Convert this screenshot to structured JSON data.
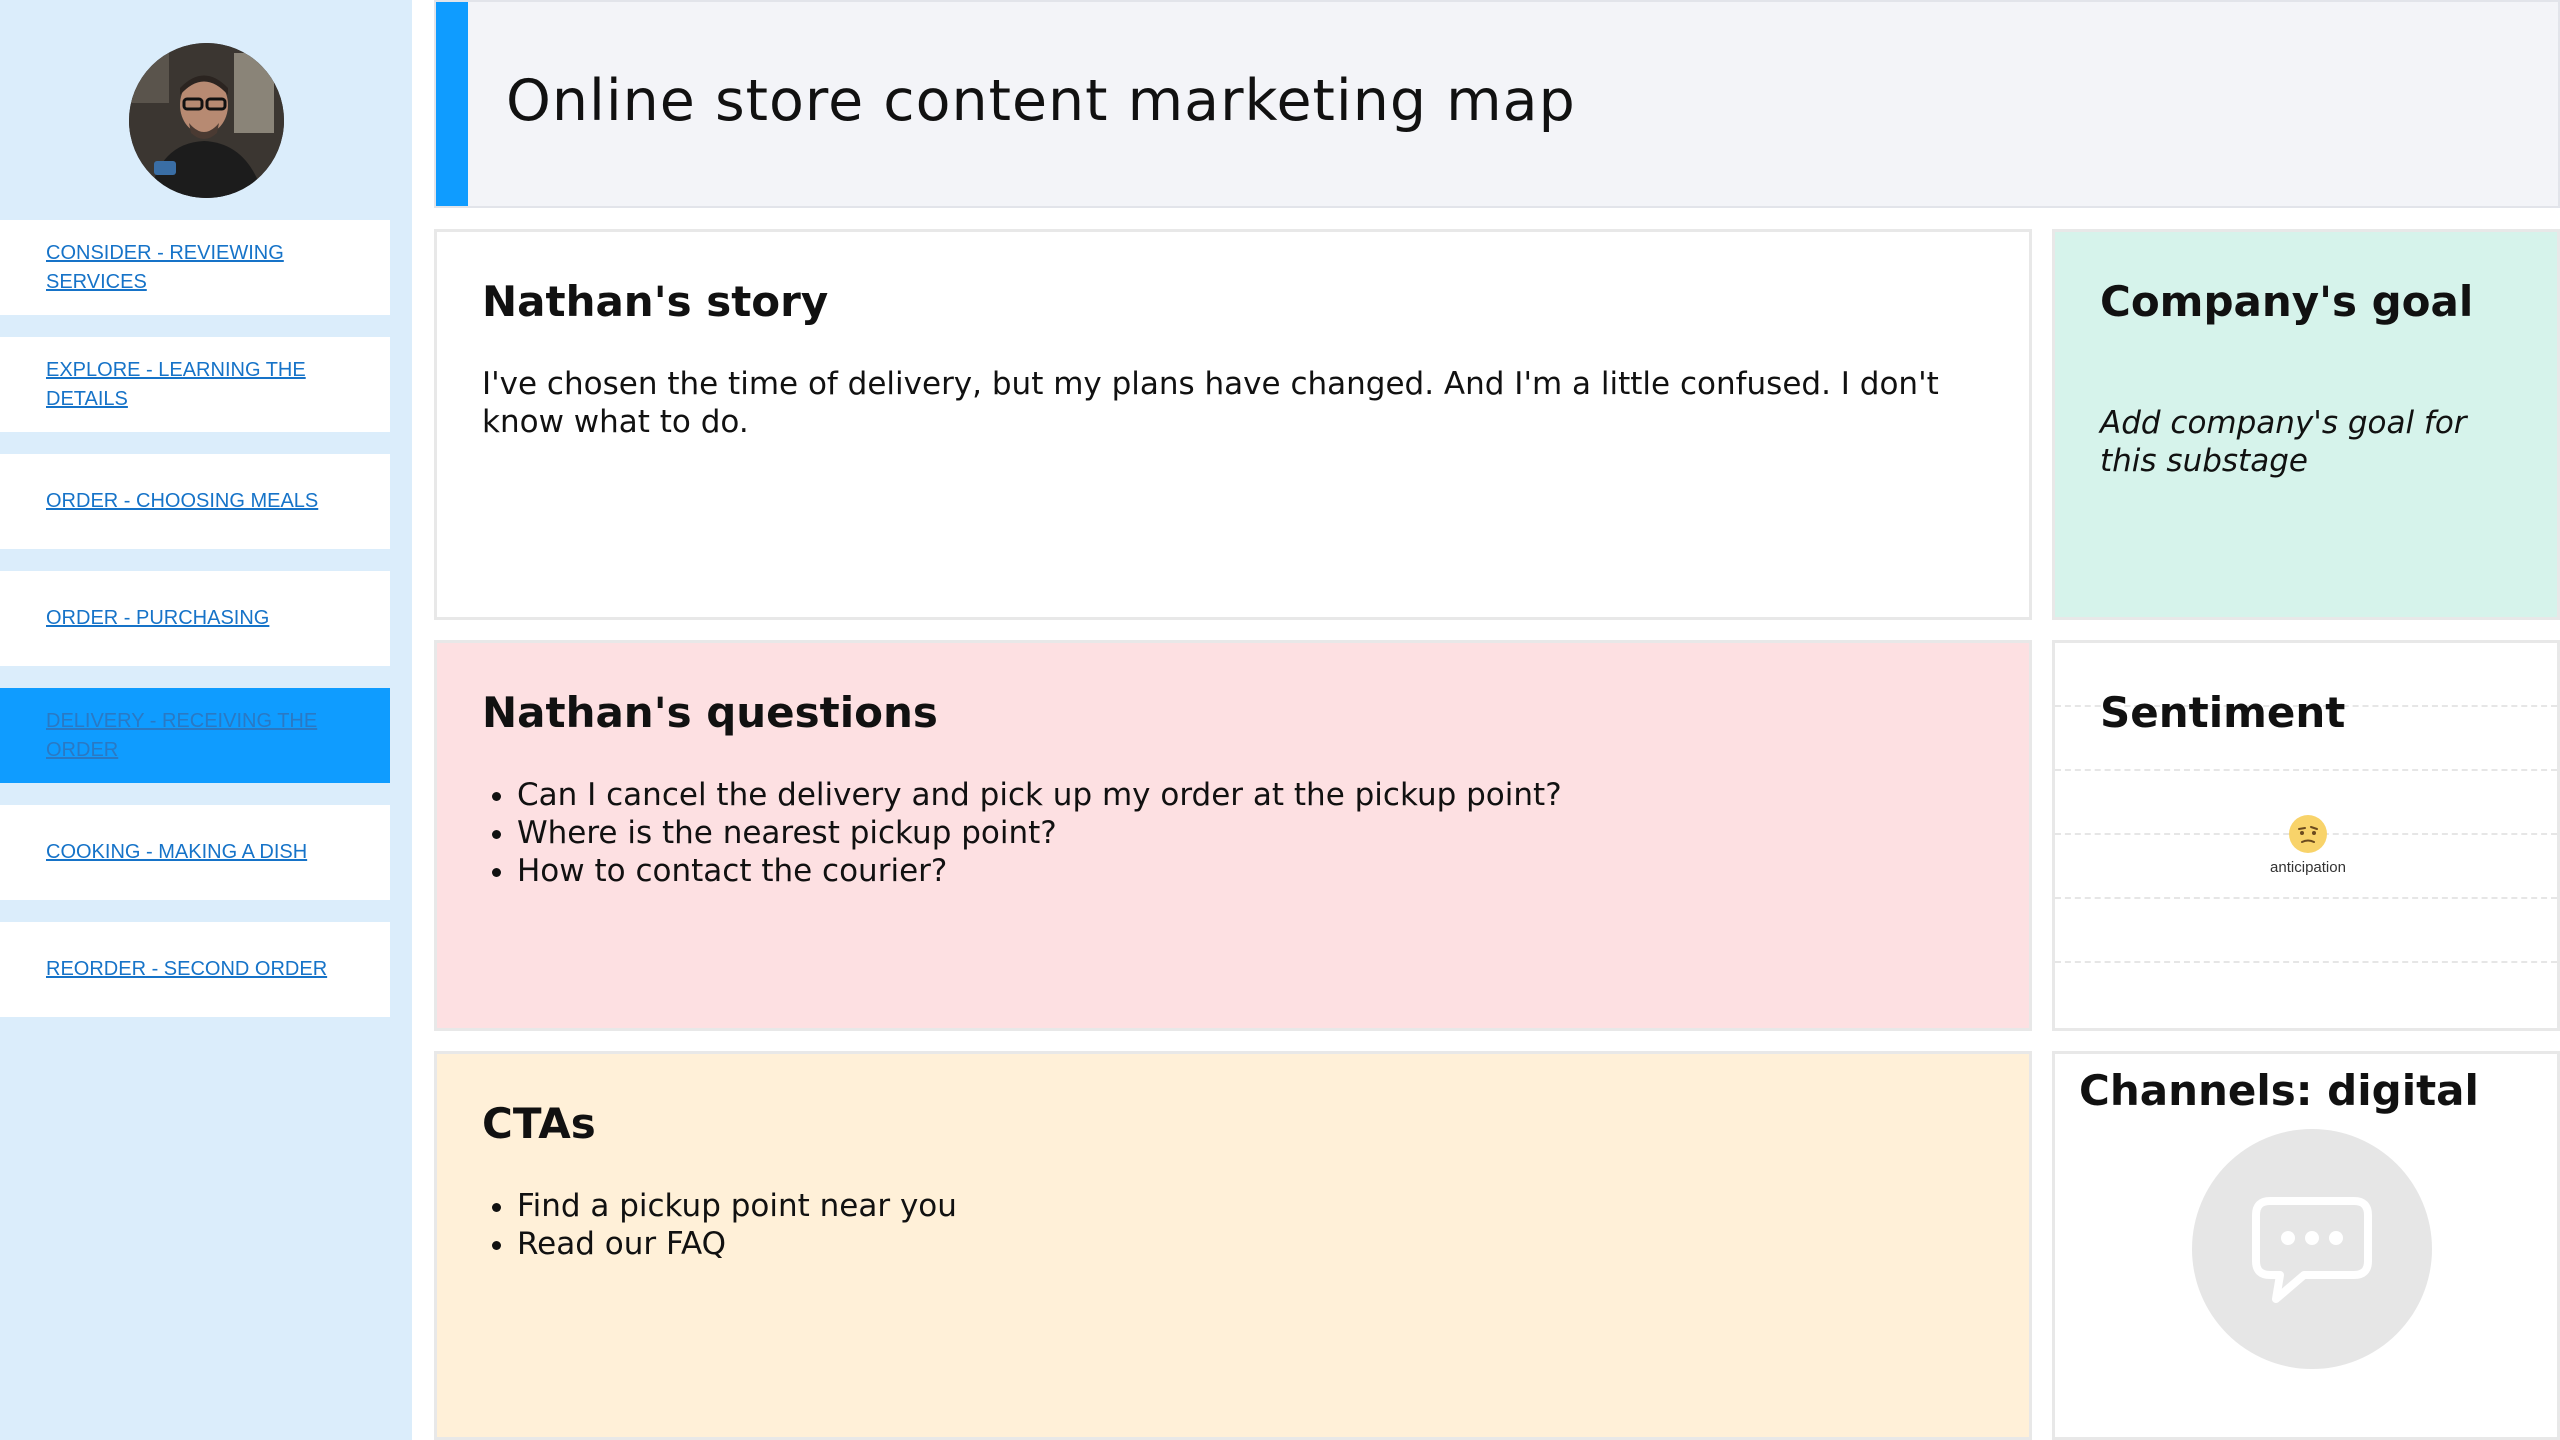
{
  "header": {
    "title": "Online store content marketing map"
  },
  "sidebar": {
    "items": [
      {
        "label": "CONSIDER - REVIEWING SERVICES",
        "active": false
      },
      {
        "label": "EXPLORE - LEARNING THE DETAILS",
        "active": false
      },
      {
        "label": "ORDER - CHOOSING MEALS",
        "active": false
      },
      {
        "label": "ORDER - PURCHASING",
        "active": false
      },
      {
        "label": "DELIVERY - RECEIVING THE ORDER",
        "active": true
      },
      {
        "label": "COOKING - MAKING A DISH",
        "active": false
      },
      {
        "label": "REORDER - SECOND ORDER",
        "active": false
      }
    ]
  },
  "story": {
    "title": "Nathan's story",
    "text": "I've chosen the time of delivery, but my plans have changed. And I'm a little confused. I don't know what to do."
  },
  "goal": {
    "title": "Company's goal",
    "text": "Add company's goal for this substage"
  },
  "questions": {
    "title": "Nathan's questions",
    "items": [
      "Can I cancel the delivery and pick up my order at the pickup point?",
      "Where is the nearest pickup point?",
      "How to contact the courier?"
    ]
  },
  "sentiment": {
    "title": "Sentiment",
    "emotion": "anticipation",
    "icon": "anticipation-emoji-icon"
  },
  "ctas": {
    "title": "CTAs",
    "items": [
      "Find a pickup point near you",
      "Read our FAQ"
    ]
  },
  "channels": {
    "title": "Channels: digital",
    "icon": "chat-bubble-icon"
  },
  "colors": {
    "accent": "#0f9cff",
    "sidebar_bg": "#dbedfb",
    "goal_bg": "#d6f3eb",
    "questions_bg": "#fde0e2",
    "ctas_bg": "#fff0d8",
    "link": "#1673c8"
  }
}
